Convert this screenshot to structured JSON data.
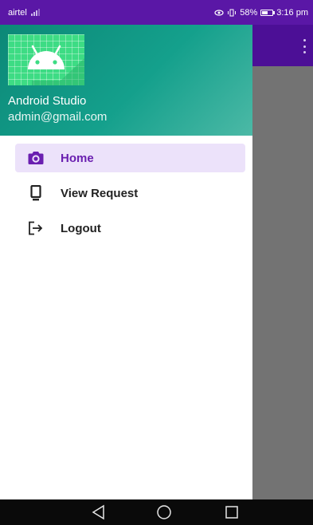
{
  "status_bar": {
    "carrier": "airtel",
    "battery_percent": "58%",
    "battery_level": 0.58,
    "time": "3:16 pm"
  },
  "drawer": {
    "header": {
      "name": "Android Studio",
      "email": "admin@gmail.com",
      "gradient_colors": [
        "#0c8877",
        "#4cb9a6"
      ]
    },
    "items": [
      {
        "label": "Home",
        "icon": "camera-icon",
        "selected": true
      },
      {
        "label": "View Request",
        "icon": "phone-device-icon",
        "selected": false
      },
      {
        "label": "Logout",
        "icon": "logout-icon",
        "selected": false
      }
    ]
  },
  "toolbar": {
    "overflow_icon": "more-vert-icon"
  },
  "nav_bar": {
    "buttons": [
      "back-triangle-icon",
      "home-circle-icon",
      "recents-square-icon"
    ]
  },
  "colors": {
    "primary": "#5a17a6",
    "accent_selected_bg": "#ece2fa",
    "accent_selected_text": "#6a1fb0",
    "scrim": "#737373"
  }
}
